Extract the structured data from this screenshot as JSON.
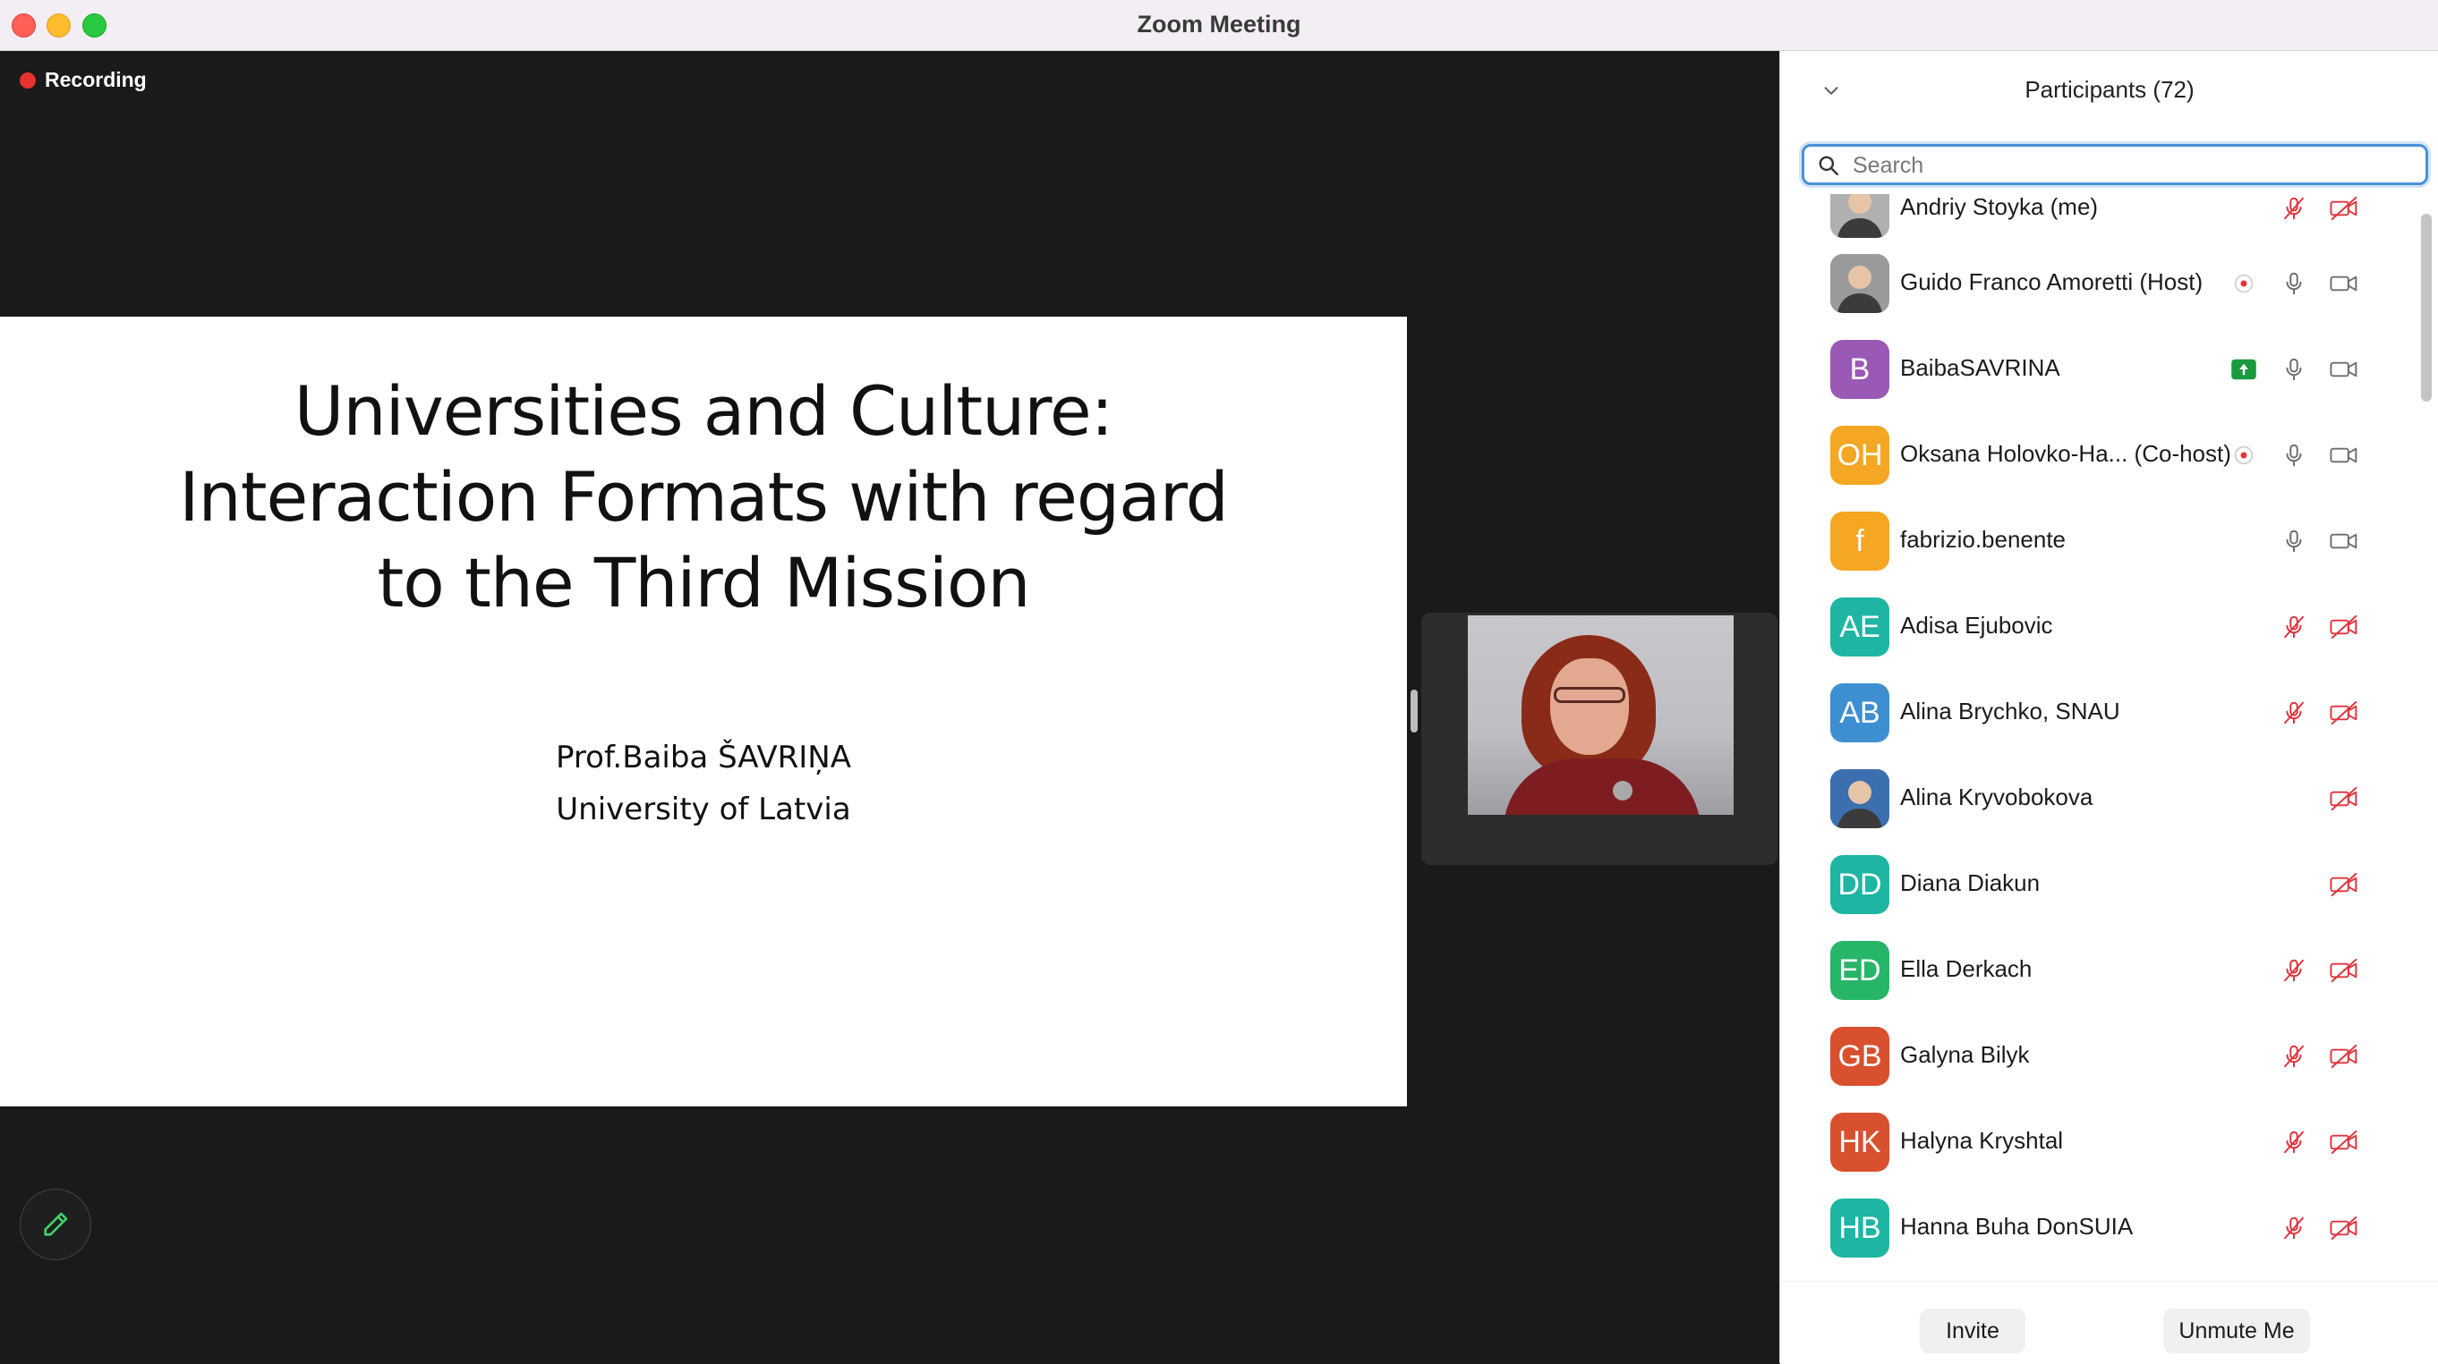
{
  "window": {
    "title": "Zoom Meeting"
  },
  "meeting": {
    "recording_label": "Recording",
    "slide": {
      "title_lines": [
        "Universities and Culture:",
        "Interaction Formats with regard",
        "to the Third Mission"
      ],
      "author": "Prof.Baiba ŠAVRIŅA",
      "affiliation": "University of Latvia"
    }
  },
  "panel": {
    "title": "Participants (72)",
    "search": {
      "placeholder": "Search",
      "value": ""
    },
    "participants": [
      {
        "name": "Andriy Stoyka (me)",
        "initials": "",
        "avatar": "photo",
        "color": "#b0b0b0",
        "status": "",
        "mic": "muted",
        "video": "off"
      },
      {
        "name": "Guido Franco Amoretti (Host)",
        "initials": "",
        "avatar": "photo",
        "color": "#9a9a9a",
        "status": "recording",
        "mic": "on",
        "video": "on"
      },
      {
        "name": "BaibaSAVRINA",
        "initials": "B",
        "avatar": "initials",
        "color": "#9b59b6",
        "status": "sharing",
        "mic": "on",
        "video": "on"
      },
      {
        "name": "Oksana Holovko-Ha...  (Co-host)",
        "initials": "OH",
        "avatar": "initials",
        "color": "#f5a623",
        "status": "recording",
        "mic": "on",
        "video": "on"
      },
      {
        "name": "fabrizio.benente",
        "initials": "f",
        "avatar": "initials",
        "color": "#f5a623",
        "status": "",
        "mic": "on",
        "video": "on"
      },
      {
        "name": "Adisa Ejubovic",
        "initials": "AE",
        "avatar": "initials",
        "color": "#1fb5a3",
        "status": "",
        "mic": "muted",
        "video": "off"
      },
      {
        "name": "Alina Brychko, SNAU",
        "initials": "AB",
        "avatar": "initials",
        "color": "#3d8fd1",
        "status": "",
        "mic": "muted",
        "video": "off"
      },
      {
        "name": "Alina Kryvobokova",
        "initials": "",
        "avatar": "photo",
        "color": "#3b6fb0",
        "status": "",
        "mic": "",
        "video": "off"
      },
      {
        "name": "Diana Diakun",
        "initials": "DD",
        "avatar": "initials",
        "color": "#1fb5a3",
        "status": "",
        "mic": "",
        "video": "off"
      },
      {
        "name": "Ella Derkach",
        "initials": "ED",
        "avatar": "initials",
        "color": "#27b56a",
        "status": "",
        "mic": "muted",
        "video": "off"
      },
      {
        "name": "Galyna Bilyk",
        "initials": "GB",
        "avatar": "initials",
        "color": "#d9502f",
        "status": "",
        "mic": "muted",
        "video": "off"
      },
      {
        "name": "Halyna Kryshtal",
        "initials": "HK",
        "avatar": "initials",
        "color": "#d9502f",
        "status": "",
        "mic": "muted",
        "video": "off"
      },
      {
        "name": "Hanna Buha DonSUIA",
        "initials": "HB",
        "avatar": "initials",
        "color": "#1fb5a3",
        "status": "",
        "mic": "muted",
        "video": "off"
      }
    ],
    "footer": {
      "invite_label": "Invite",
      "unmute_label": "Unmute Me"
    }
  },
  "colors": {
    "muted_red": "#e0343c",
    "icon_gray": "#6e6e6e",
    "sharing_green": "#1a9a3d",
    "accent_blue": "#4a90d9"
  }
}
